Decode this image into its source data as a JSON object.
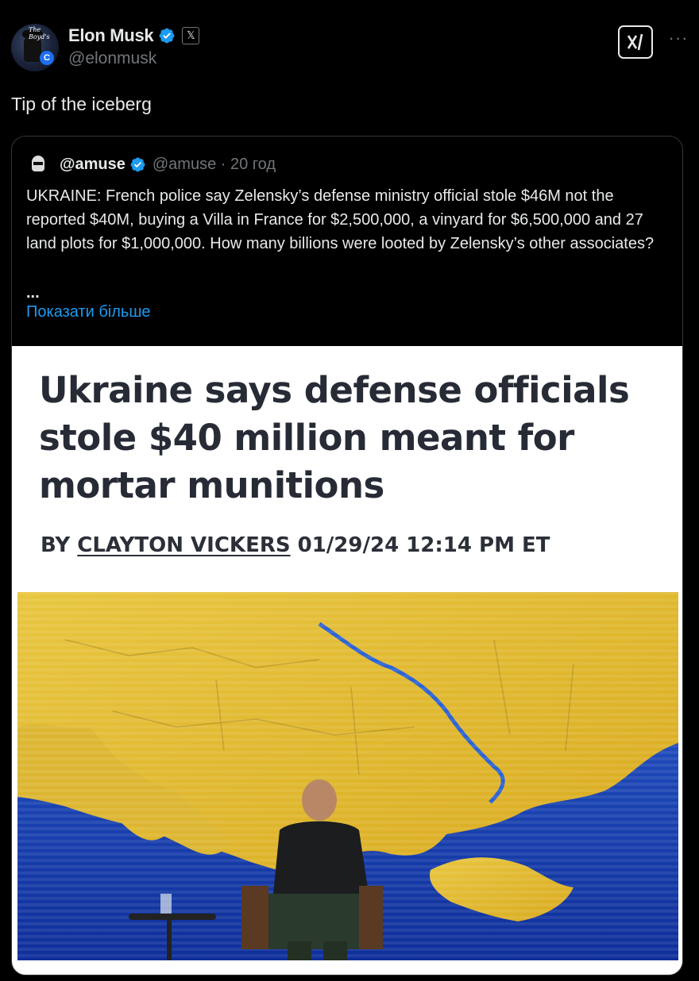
{
  "post": {
    "author_name": "Elon Musk",
    "author_handle": "@elonmusk",
    "text": "Tip of the iceberg",
    "avatar_text": "The Boyd's",
    "avatar_badge": "C"
  },
  "quoted": {
    "author_name": "@amuse",
    "meta": "@amuse · 20 год",
    "text": "UKRAINE: French police say Zelensky’s defense ministry official stole $46M not the reported $40M, buying a Villa in France for $2,500,000, a vinyard for $6,500,000 and 27 land plots for $1,000,000. How many billions were looted by Zelensky’s other associates?",
    "ellipsis": "...",
    "show_more": "Показати більше"
  },
  "article": {
    "headline": "Ukraine says defense officials stole $40 million meant for mortar munitions",
    "byline_prefix": "BY ",
    "byline_author": "CLAYTON VICKERS",
    "byline_date": " 01/29/24 12:14 PM ET"
  },
  "icons": {
    "verified": "verified-badge-icon",
    "x_badge": "x-affiliation-icon",
    "grok": "grok-icon",
    "more": "more-icon"
  },
  "colors": {
    "background": "#000000",
    "text": "#e7e9ea",
    "muted": "#71767b",
    "link": "#1d9bf0",
    "verified": "#1d9bf0"
  }
}
